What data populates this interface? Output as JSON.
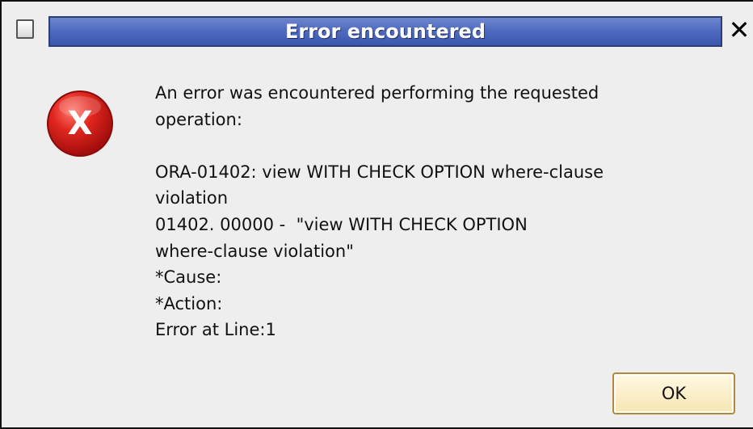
{
  "dialog": {
    "title": "Error encountered",
    "close_glyph": "✕",
    "icon": "error-x-icon",
    "icon_glyph": "X",
    "message": "An error was encountered performing the requested\noperation:\n\nORA-01402: view WITH CHECK OPTION where-clause\nviolation\n01402. 00000 -  \"view WITH CHECK OPTION\nwhere-clause violation\"\n*Cause:\n*Action:\nError at Line:1",
    "ok_label": "OK"
  },
  "colors": {
    "title_bar": "#4f6bc0",
    "dialog_background": "#eeeeee",
    "error_icon": "#d81b1b",
    "ok_button": "#f7e6b2"
  }
}
